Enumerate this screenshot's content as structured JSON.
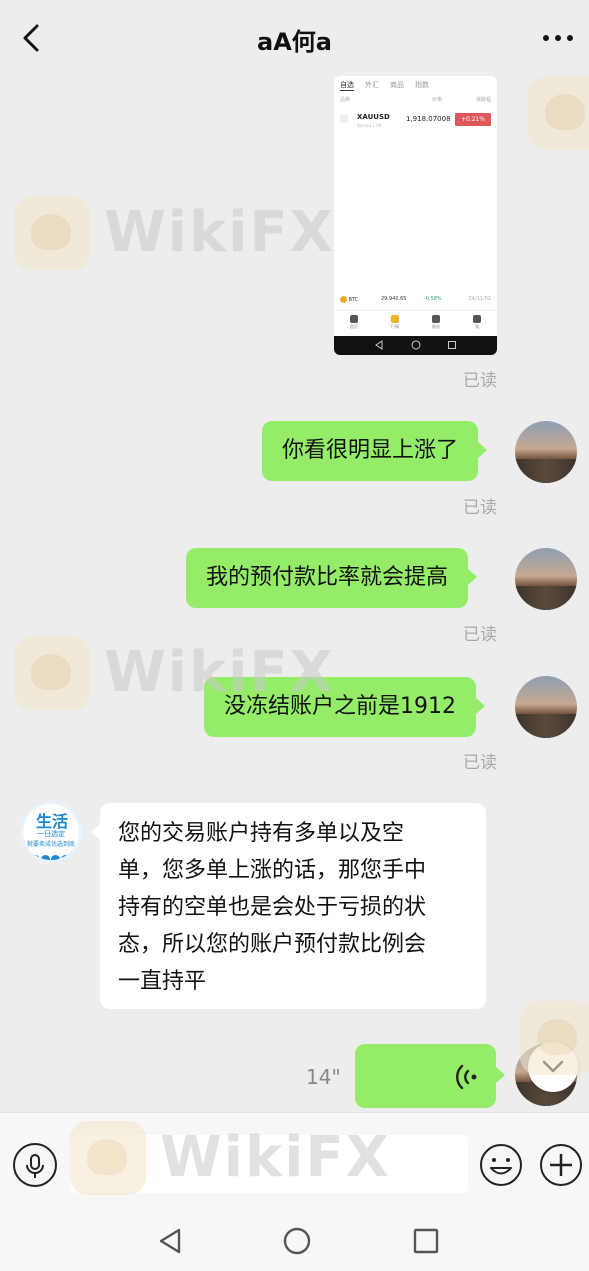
{
  "header": {
    "title": "aA何a",
    "back_icon": "chevron-left-icon",
    "more_icon": "ellipsis-icon"
  },
  "screenshot_thumb": {
    "tabs": [
      "自选",
      "外汇",
      "商品",
      "指数"
    ],
    "col_headers": [
      "品种",
      "价格",
      "涨跌幅"
    ],
    "row": {
      "symbol": "XAUUSD",
      "sub": "Spread 1.04",
      "price": "1,918.07008",
      "change": "+0.21%"
    },
    "ticker": {
      "label": "BTC",
      "value": "29,940.65",
      "change": "-0.58%",
      "time": "24/11/02"
    },
    "nav": [
      "首页",
      "行情",
      "服务",
      "我"
    ],
    "colors": {
      "up": "#e0585c",
      "down": "#28a06a",
      "active_nav": "#f0b429"
    }
  },
  "messages": [
    {
      "id": "m1",
      "direction": "out",
      "type": "image",
      "status": "已读"
    },
    {
      "id": "m2",
      "direction": "out",
      "type": "text",
      "text": "你看很明显上涨了",
      "status": "已读"
    },
    {
      "id": "m3",
      "direction": "out",
      "type": "text",
      "text": "我的预付款比率就会提高",
      "status": "已读"
    },
    {
      "id": "m4",
      "direction": "out",
      "type": "text",
      "text": "没冻结账户之前是1912",
      "status": "已读"
    },
    {
      "id": "m5",
      "direction": "in",
      "type": "text",
      "lines": [
        "您的交易账户持有多单以及空",
        "单，您多单上涨的话，那您手中",
        "持有的空单也是会处于亏损的状",
        "态，所以您的账户预付款比例会",
        "一直持平"
      ]
    },
    {
      "id": "m6",
      "direction": "out",
      "type": "voice",
      "duration": "14\""
    }
  ],
  "other_avatar": {
    "brand": "生活",
    "line2": "一日选定",
    "line3": "就要卖成优选到底"
  },
  "input_bar": {
    "voice_icon": "microphone-icon",
    "emoji_icon": "smiley-icon",
    "plus_icon": "plus-circle-icon",
    "placeholder": ""
  },
  "watermark": {
    "text": "WikiFX"
  },
  "colors": {
    "bubble_out": "#95ec69",
    "bubble_in": "#ffffff",
    "background": "#ededed",
    "read_status": "#a9a9a9"
  }
}
